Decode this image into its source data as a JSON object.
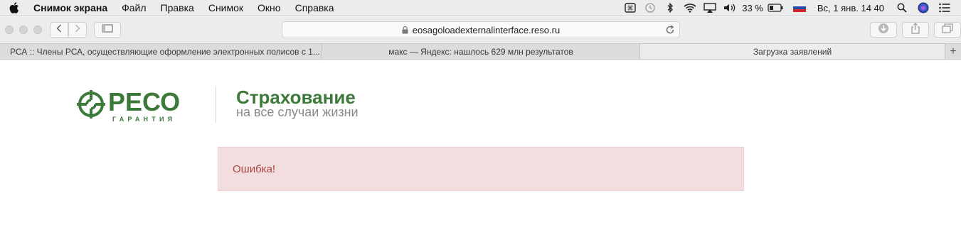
{
  "menubar": {
    "app_name": "Снимок экрана",
    "items": [
      "Файл",
      "Правка",
      "Снимок",
      "Окно",
      "Справка"
    ],
    "battery": "33 %",
    "datetime": "Вс, 1 янв.  14 40"
  },
  "toolbar": {
    "url": "eosagoloadexternalinterface.reso.ru"
  },
  "tabs": [
    {
      "label": "РСА :: Члены РСА, осуществляющие оформление электронных полисов с 1..."
    },
    {
      "label": "макс — Яндекс: нашлось 629 млн результатов"
    },
    {
      "label": "Загрузка заявлений"
    }
  ],
  "page": {
    "logo_name": "РЕСО",
    "logo_sub": "ГАРАНТИЯ",
    "slogan_title": "Страхование",
    "slogan_sub": "на все случаи жизни",
    "error_text": "Ошибка!"
  },
  "colors": {
    "brand_green": "#3c7a3a",
    "alert_bg": "#f2dede",
    "alert_text": "#a94442"
  }
}
